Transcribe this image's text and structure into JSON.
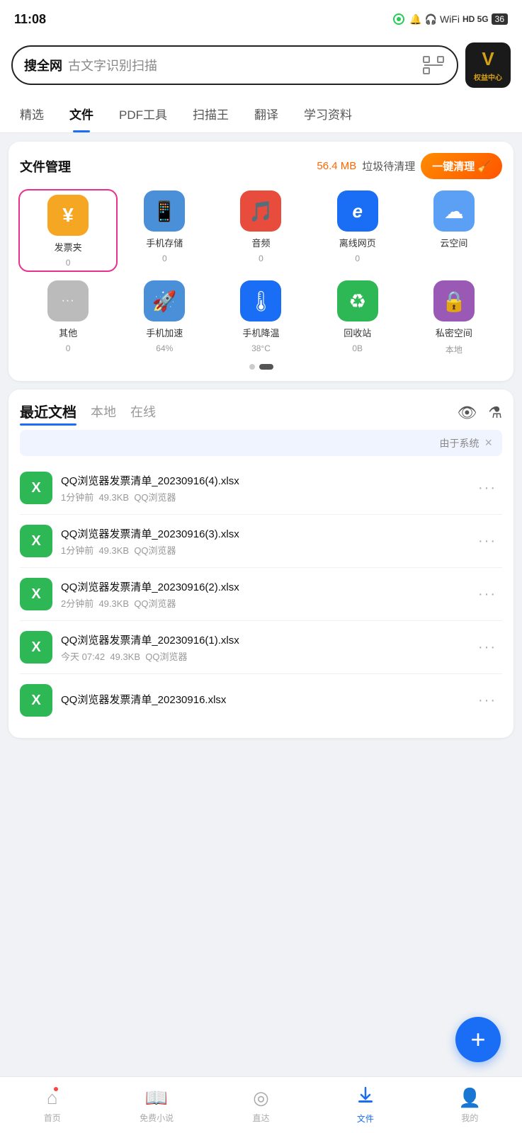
{
  "statusBar": {
    "time": "11:08",
    "batteryLevel": "36"
  },
  "searchBar": {
    "label": "搜全网",
    "placeholder": "古文字识别扫描",
    "vipLabel": "V",
    "vipSub": "权益中心"
  },
  "navTabs": [
    {
      "id": "jingxuan",
      "label": "精选",
      "active": false
    },
    {
      "id": "wenjian",
      "label": "文件",
      "active": true
    },
    {
      "id": "pdf",
      "label": "PDF工具",
      "active": false
    },
    {
      "id": "saomiaowang",
      "label": "扫描王",
      "active": false
    },
    {
      "id": "fanyi",
      "label": "翻译",
      "active": false
    },
    {
      "id": "xuexi",
      "label": "学习资料",
      "active": false
    }
  ],
  "fileManager": {
    "title": "文件管理",
    "trashSize": "56.4 MB",
    "trashLabel": "垃圾待清理",
    "cleanLabel": "一键清理",
    "icons": [
      {
        "id": "fapiaojia",
        "label": "发票夹",
        "count": "0",
        "bg": "#f5a623",
        "symbol": "¥",
        "highlighted": true
      },
      {
        "id": "shouji",
        "label": "手机存储",
        "count": "0",
        "bg": "#4a90d9",
        "symbol": "📱",
        "highlighted": false
      },
      {
        "id": "yinpin",
        "label": "音频",
        "count": "0",
        "bg": "#e74c3c",
        "symbol": "🎵",
        "highlighted": false
      },
      {
        "id": "lixianwangye",
        "label": "离线网页",
        "count": "0",
        "bg": "#1a6ef5",
        "symbol": "e",
        "highlighted": false
      },
      {
        "id": "yunkongian",
        "label": "云空间",
        "count": "",
        "bg": "#5ba0f5",
        "symbol": "☁",
        "highlighted": false
      },
      {
        "id": "qita",
        "label": "其他",
        "count": "0",
        "bg": "#aaa",
        "symbol": "···",
        "highlighted": false
      },
      {
        "id": "shoujijiasubo",
        "label": "手机加速",
        "count": "64%",
        "bg": "#4a90d9",
        "symbol": "🚀",
        "highlighted": false
      },
      {
        "id": "shoujijiangwen",
        "label": "手机降温",
        "count": "38°C",
        "bg": "#1a6ef5",
        "symbol": "🌡",
        "highlighted": false
      },
      {
        "id": "huishouzhan",
        "label": "回收站",
        "count": "0B",
        "bg": "#2db755",
        "symbol": "♻",
        "highlighted": false
      },
      {
        "id": "mimikongian",
        "label": "私密空间",
        "count": "本地",
        "bg": "#9b59b6",
        "symbol": "🔒",
        "highlighted": false
      }
    ],
    "dots": [
      {
        "active": false
      },
      {
        "active": true
      }
    ]
  },
  "recentDocs": {
    "title": "最近文档",
    "tabs": [
      {
        "label": "最近文档",
        "active": true
      },
      {
        "label": "本地",
        "active": false
      },
      {
        "label": "在线",
        "active": false
      }
    ],
    "systemNotice": "由于系统",
    "files": [
      {
        "name": "QQ浏览器发票清单_20230916(4).xlsx",
        "time": "1分钟前",
        "size": "49.3KB",
        "source": "QQ浏览器",
        "type": "xlsx"
      },
      {
        "name": "QQ浏览器发票清单_20230916(3).xlsx",
        "time": "1分钟前",
        "size": "49.3KB",
        "source": "QQ浏览器",
        "type": "xlsx"
      },
      {
        "name": "QQ浏览器发票清单_20230916(2).xlsx",
        "time": "2分钟前",
        "size": "49.3KB",
        "source": "QQ浏览器",
        "type": "xlsx"
      },
      {
        "name": "QQ浏览器发票清单_20230916(1).xlsx",
        "time": "今天 07:42",
        "size": "49.3KB",
        "source": "QQ浏览器",
        "type": "xlsx"
      },
      {
        "name": "QQ浏览器发票清单_20230916.xlsx",
        "time": "",
        "size": "",
        "source": "",
        "type": "xlsx"
      }
    ]
  },
  "fab": {
    "label": "+"
  },
  "bottomNav": [
    {
      "id": "home",
      "label": "首页",
      "icon": "⌂",
      "active": false,
      "hasDot": true
    },
    {
      "id": "novel",
      "label": "免费小说",
      "icon": "📖",
      "active": false,
      "hasDot": false
    },
    {
      "id": "zhida",
      "label": "直达",
      "icon": "◎",
      "active": false,
      "hasDot": false
    },
    {
      "id": "file",
      "label": "文件",
      "icon": "⬇",
      "active": true,
      "hasDot": false
    },
    {
      "id": "mine",
      "label": "我的",
      "icon": "👤",
      "active": false,
      "hasDot": false
    }
  ]
}
